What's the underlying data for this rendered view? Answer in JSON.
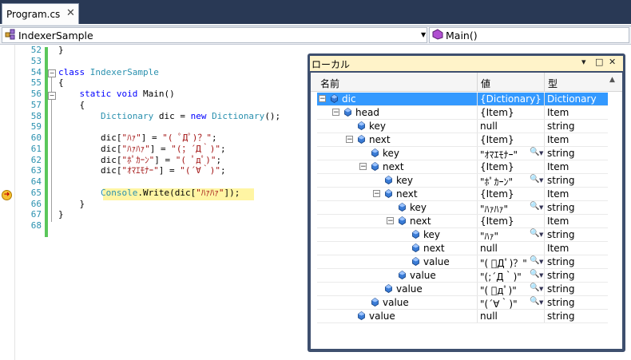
{
  "tab": {
    "label": "Program.cs",
    "close": "✕"
  },
  "nav": {
    "class_combo": "IndexerSample",
    "member_combo": "Main()",
    "arrow": "▼"
  },
  "code": [
    {
      "num": "52",
      "html": "}"
    },
    {
      "num": "53",
      "html": ""
    },
    {
      "num": "54",
      "html": "<span class=\"kw\">class</span> <span class=\"ty\">IndexerSample</span>"
    },
    {
      "num": "55",
      "html": "{"
    },
    {
      "num": "56",
      "html": "    <span class=\"kw\">static</span> <span class=\"kw\">void</span> Main()"
    },
    {
      "num": "57",
      "html": "    {"
    },
    {
      "num": "58",
      "html": "        <span class=\"ty\">Dictionary</span> dic = <span class=\"kw\">new</span> <span class=\"ty\">Dictionary</span>();"
    },
    {
      "num": "59",
      "html": ""
    },
    {
      "num": "60",
      "html": "        dic[<span class=\"st\">\"ﾊｧ\"</span>] = <span class=\"st\">\"( ﾟДﾟ)？\"</span>;"
    },
    {
      "num": "61",
      "html": "        dic[<span class=\"st\">\"ﾊｧﾊｧ\"</span>] = <span class=\"st\">\"(；´Д｀)\"</span>;"
    },
    {
      "num": "62",
      "html": "        dic[<span class=\"st\">\"ﾎﾟｶｰﾝ\"</span>] = <span class=\"st\">\"( ﾟдﾟ)\"</span>;"
    },
    {
      "num": "63",
      "html": "        dic[<span class=\"st\">\"ｵﾏｴﾓﾅｰ\"</span>] = <span class=\"st\">\"(´∀｀)\"</span>;"
    },
    {
      "num": "64",
      "html": ""
    },
    {
      "num": "65",
      "html": "        <span class=\"ty\">Console</span>.Write(dic[<span class=\"st\">\"ﾊｧﾊｧ\"</span>]);"
    },
    {
      "num": "66",
      "html": "    }"
    },
    {
      "num": "67",
      "html": "}"
    },
    {
      "num": "68",
      "html": ""
    }
  ],
  "locals": {
    "title": "ローカル",
    "buttons": [
      "▾",
      "□",
      "✕"
    ],
    "columns": {
      "name": "名前",
      "value": "値",
      "type": "型"
    },
    "rows": [
      {
        "indent": 0,
        "exp": "−",
        "name": "dic",
        "value": "{Dictionary}",
        "type": "Dictionary",
        "selected": true,
        "mag": false
      },
      {
        "indent": 1,
        "exp": "−",
        "name": "head",
        "value": "{Item}",
        "type": "Item",
        "selected": false,
        "mag": false
      },
      {
        "indent": 2,
        "exp": "",
        "name": "key",
        "value": "null",
        "type": "string",
        "selected": false,
        "mag": false
      },
      {
        "indent": 2,
        "exp": "−",
        "name": "next",
        "value": "{Item}",
        "type": "Item",
        "selected": false,
        "mag": false
      },
      {
        "indent": 3,
        "exp": "",
        "name": "key",
        "value": "\"ｵﾏｴﾓﾅｰ\"",
        "type": "string",
        "selected": false,
        "mag": true
      },
      {
        "indent": 3,
        "exp": "−",
        "name": "next",
        "value": "{Item}",
        "type": "Item",
        "selected": false,
        "mag": false
      },
      {
        "indent": 4,
        "exp": "",
        "name": "key",
        "value": "\"ﾎﾟｶｰﾝ\"",
        "type": "string",
        "selected": false,
        "mag": true
      },
      {
        "indent": 4,
        "exp": "−",
        "name": "next",
        "value": "{Item}",
        "type": "Item",
        "selected": false,
        "mag": false
      },
      {
        "indent": 5,
        "exp": "",
        "name": "key",
        "value": "\"ﾊｧﾊｧ\"",
        "type": "string",
        "selected": false,
        "mag": true
      },
      {
        "indent": 5,
        "exp": "−",
        "name": "next",
        "value": "{Item}",
        "type": "Item",
        "selected": false,
        "mag": false
      },
      {
        "indent": 6,
        "exp": "",
        "name": "key",
        "value": "\"ﾊｧ\"",
        "type": "string",
        "selected": false,
        "mag": true
      },
      {
        "indent": 6,
        "exp": "",
        "name": "next",
        "value": "null",
        "type": "Item",
        "selected": false,
        "mag": false
      },
      {
        "indent": 6,
        "exp": "",
        "name": "value",
        "value": "\"( ﾟДﾟ)？\"",
        "type": "string",
        "selected": false,
        "mag": true
      },
      {
        "indent": 5,
        "exp": "",
        "name": "value",
        "value": "\"(;´Д｀)\"",
        "type": "string",
        "selected": false,
        "mag": true
      },
      {
        "indent": 4,
        "exp": "",
        "name": "value",
        "value": "\"( ﾟдﾟ)\"",
        "type": "string",
        "selected": false,
        "mag": true
      },
      {
        "indent": 3,
        "exp": "",
        "name": "value",
        "value": "\"(´∀｀)\"",
        "type": "string",
        "selected": false,
        "mag": true
      },
      {
        "indent": 2,
        "exp": "",
        "name": "value",
        "value": "null",
        "type": "string",
        "selected": false,
        "mag": false
      }
    ],
    "magnifier": "🔍",
    "dropdown": "▼"
  },
  "colors": {
    "tabstrip": "#293955",
    "line_number": "#2b91af",
    "keyword": "#0000ff",
    "type": "#2b91af",
    "string": "#a31515",
    "current_line": "#fff5a3",
    "selection": "#3399ff",
    "tool_window_title": "#fff3c9"
  }
}
